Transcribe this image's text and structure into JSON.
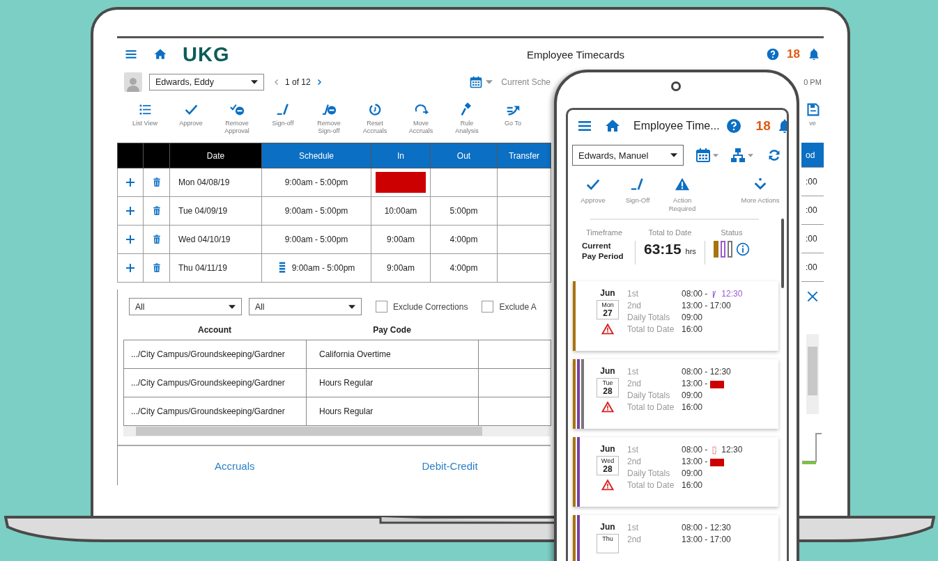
{
  "laptop": {
    "header": {
      "logo": "UKG",
      "title": "Employee Timecards",
      "notification_count": "18"
    },
    "employee_select": {
      "value": "Edwards, Eddy"
    },
    "pager": "1 of 12",
    "timeframe_label": "Current Sche",
    "time_fragment": "0 PM",
    "toolbar": [
      {
        "kind": "list",
        "label": "List View"
      },
      {
        "kind": "approve",
        "label": "Approve"
      },
      {
        "kind": "remove_approval",
        "label": "Remove Approval"
      },
      {
        "kind": "sign_off",
        "label": "Sign-off"
      },
      {
        "kind": "remove_sign_off",
        "label": "Remove Sign-off"
      },
      {
        "kind": "reset",
        "label": "Reset Accruals"
      },
      {
        "kind": "move",
        "label": "Move Accruals"
      },
      {
        "kind": "rule",
        "label": "Rule Analysis"
      },
      {
        "kind": "goto",
        "label": "Go To"
      }
    ],
    "toolbar_fragment": {
      "kind": "save",
      "label": "ve"
    },
    "timecard": {
      "columns": [
        "Date",
        "Schedule",
        "In",
        "Out",
        "Transfer"
      ],
      "right_column": "od",
      "rows": [
        {
          "date": "Mon 04/08/19",
          "schedule": "9:00am - 5:00pm",
          "in_missing": true,
          "schedule_note": false,
          "right": ":00"
        },
        {
          "date": "Tue 04/09/19",
          "schedule": "9:00am - 5:00pm",
          "in": "10:00am",
          "out": "5:00pm",
          "in_missing": false,
          "schedule_note": false,
          "right": ":00"
        },
        {
          "date": "Wed 04/10/19",
          "schedule": "9:00am - 5:00pm",
          "in": "9:00am",
          "out": "4:00pm",
          "in_missing": false,
          "schedule_note": false,
          "right": ":00"
        },
        {
          "date": "Thu 04/11/19",
          "schedule": "9:00am - 5:00pm",
          "in": "9:00am",
          "out": "4:00pm",
          "in_missing": false,
          "schedule_note": true,
          "right": ":00"
        }
      ]
    },
    "filters": [
      "All",
      "All"
    ],
    "checkboxes": [
      {
        "label": "Exclude Corrections",
        "checked": false
      },
      {
        "label": "Exclude A",
        "checked": false
      }
    ],
    "totals": {
      "columns": [
        "Account",
        "Pay Code"
      ],
      "rows": [
        {
          "account": ".../City Campus/Groundskeeping/Gardner",
          "pay_code": "California Overtime"
        },
        {
          "account": ".../City Campus/Groundskeeping/Gardner",
          "pay_code": "Hours Regular"
        },
        {
          "account": ".../City Campus/Groundskeeping/Gardner",
          "pay_code": "Hours Regular"
        }
      ]
    },
    "footer_tabs": [
      "Accruals",
      "Debit-Credit"
    ]
  },
  "phone": {
    "header": {
      "title": "Employee Time...",
      "notification_count": "18"
    },
    "employee_select": {
      "value": "Edwards, Manuel"
    },
    "actions": [
      {
        "kind": "approve",
        "label": "Approve"
      },
      {
        "kind": "sign_off",
        "label": "Sign-Off"
      },
      {
        "kind": "action_required",
        "label": "Action Required"
      },
      {
        "kind": "more",
        "label": "More Actions"
      }
    ],
    "summary": {
      "timeframe_label": "Timeframe",
      "timeframe": "Current Pay Period",
      "total_label": "Total to Date",
      "total": "63:15",
      "total_unit": "hrs",
      "status_label": "Status",
      "status": [
        {
          "color": "#a8740f",
          "filled": true
        },
        {
          "color": "#9b59d0",
          "filled": false
        },
        {
          "color": "#777777",
          "filled": false
        }
      ]
    },
    "cards": [
      {
        "month": "Jun",
        "weekday": "Mon",
        "day": "27",
        "warning": true,
        "stripes": [
          {
            "color": "#a8740f"
          }
        ],
        "lines": [
          {
            "label": "1st",
            "value": "08:00 -",
            "end": "12:30",
            "kind": "edited"
          },
          {
            "label": "2nd",
            "value": "13:00 - 17:00",
            "kind": "plain"
          },
          {
            "label": "Daily Totals",
            "value": "09:00",
            "kind": "plain"
          },
          {
            "label": "Total to Date",
            "value": "16:00",
            "kind": "plain"
          }
        ]
      },
      {
        "month": "Jun",
        "weekday": "Tue",
        "day": "28",
        "warning": true,
        "stripes": [
          {
            "color": "#a8740f"
          },
          {
            "color": "#7b3fa0"
          },
          {
            "color": "#777777"
          }
        ],
        "lines": [
          {
            "label": "1st",
            "value": "08:00 - 12:30",
            "kind": "plain"
          },
          {
            "label": "2nd",
            "value": "13:00 -",
            "kind": "missing"
          },
          {
            "label": "Daily Totals",
            "value": "09:00",
            "kind": "plain"
          },
          {
            "label": "Total to Date",
            "value": "16:00",
            "kind": "plain"
          }
        ]
      },
      {
        "month": "Jun",
        "weekday": "Wed",
        "day": "28",
        "warning": true,
        "stripes": [
          {
            "color": "#a8740f"
          },
          {
            "color": "#7b3fa0"
          }
        ],
        "lines": [
          {
            "label": "1st",
            "value": "08:00 -",
            "end": "12:30",
            "kind": "flagged"
          },
          {
            "label": "2nd",
            "value": "13:00 -",
            "kind": "missing"
          },
          {
            "label": "Daily Totals",
            "value": "09:00",
            "kind": "plain"
          },
          {
            "label": "Total to Date",
            "value": "16:00",
            "kind": "plain"
          }
        ]
      },
      {
        "month": "Jun",
        "weekday": "Thu",
        "warning": false,
        "stripes": [
          {
            "color": "#a8740f"
          },
          {
            "color": "#7b3fa0"
          }
        ],
        "lines": [
          {
            "label": "1st",
            "value": "08:00 - 12:30",
            "kind": "plain"
          },
          {
            "label": "2nd",
            "value": "13:00 - 17:00",
            "kind": "plain"
          }
        ]
      }
    ]
  }
}
